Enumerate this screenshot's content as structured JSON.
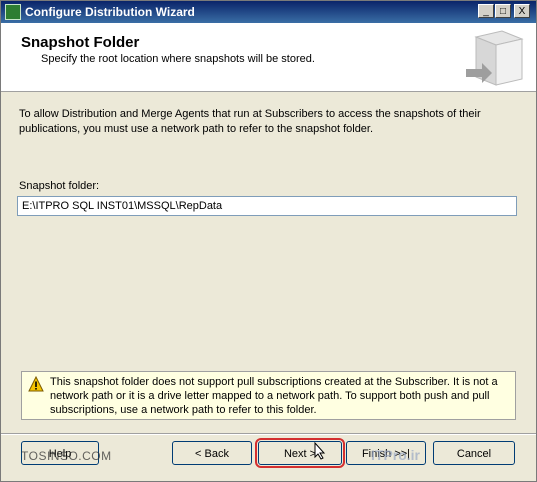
{
  "window": {
    "title": "Configure Distribution Wizard",
    "controls": {
      "minimize": "_",
      "maximize": "□",
      "close": "X"
    }
  },
  "header": {
    "heading": "Snapshot Folder",
    "subheading": "Specify the root location where snapshots will be stored."
  },
  "content": {
    "intro": "To allow Distribution and Merge Agents that run at Subscribers to access the snapshots of their publications, you must use a network path to refer to the snapshot folder.",
    "folder_label": "Snapshot folder:",
    "folder_value": "E:\\ITPRO SQL INST01\\MSSQL\\RepData",
    "warning": "This snapshot folder does not support pull subscriptions created at the Subscriber. It is not a network path or it is a drive letter mapped to a network path. To support both push and pull subscriptions, use a network path to refer to this folder."
  },
  "buttons": {
    "help": "Help",
    "back": "< Back",
    "next": "Next >",
    "finish": "Finish >>|",
    "cancel": "Cancel"
  },
  "watermarks": {
    "left": "TOSINSO.COM",
    "right": "ITPro.ir"
  },
  "icons": {
    "app": "wizard-app-icon",
    "warning": "warning-triangle-icon",
    "header_art": "server-arrow-icon",
    "cursor": "mouse-pointer-icon"
  }
}
